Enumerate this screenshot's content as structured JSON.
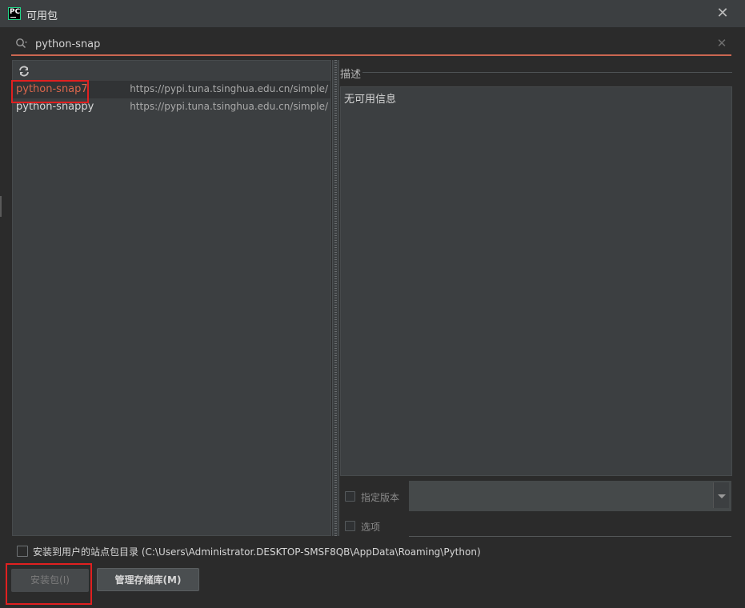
{
  "window": {
    "title": "可用包",
    "app_icon_text": "PC"
  },
  "search": {
    "value": "python-snap",
    "placeholder": ""
  },
  "packages": [
    {
      "name": "python-snap7",
      "repo": "https://pypi.tuna.tsinghua.edu.cn/simple/",
      "selected": true
    },
    {
      "name": "python-snappy",
      "repo": "https://pypi.tuna.tsinghua.edu.cn/simple/",
      "selected": false
    }
  ],
  "description": {
    "label": "描述",
    "text": "无可用信息"
  },
  "options": {
    "specify_version_label": "指定版本",
    "options_label": "选项",
    "install_to_user_site_label": "安装到用户的站点包目录 (C:\\Users\\Administrator.DESKTOP-SMSF8QB\\AppData\\Roaming\\Python)"
  },
  "buttons": {
    "install": "安装包(I)",
    "manage_repos": "管理存储库(M)"
  },
  "colors": {
    "accent": "#cb6751",
    "selected_text": "#d9664c",
    "highlight_box": "#e02020",
    "background": "#2b2b2b",
    "panel": "#3c3f41"
  }
}
